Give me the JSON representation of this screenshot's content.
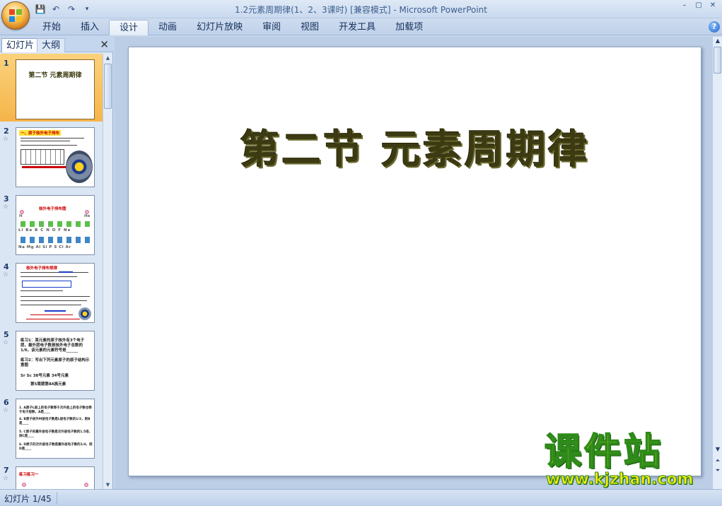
{
  "window": {
    "title": "1.2元素周期律(1、2、3课时) [兼容模式] - Microsoft PowerPoint",
    "controls": [
      "–",
      "▢",
      "✕"
    ]
  },
  "qat": {
    "save": "💾",
    "undo": "↶",
    "redo": "↷",
    "more": "▾"
  },
  "ribbon": {
    "tabs": [
      "开始",
      "插入",
      "设计",
      "动画",
      "幻灯片放映",
      "审阅",
      "视图",
      "开发工具",
      "加载项"
    ],
    "active_tab": "设计",
    "help": "?"
  },
  "left_panel": {
    "tabs": [
      "幻灯片",
      "大纲"
    ],
    "close": "✕",
    "slides": [
      {
        "num": "1",
        "title": "第二节 元素周期律"
      },
      {
        "num": "2",
        "title": "一、原子核外电子排布"
      },
      {
        "num": "3",
        "title": "核外电子排布图",
        "row1": [
          "H",
          "He"
        ],
        "row2": [
          "Li",
          "Be",
          "B",
          "C",
          "N",
          "O",
          "F",
          "Ne"
        ],
        "row3": [
          "Na",
          "Mg",
          "Al",
          "Si",
          "P",
          "S",
          "Cl",
          "Ar"
        ]
      },
      {
        "num": "4",
        "title": "核外电子排布规律"
      },
      {
        "num": "5",
        "lines": [
          "练习1：某元素的原子核外有3个电子层，最外层电子数是核外电子总数的1/6，该元素的元素符号是______",
          "练习2：写出下列元素原子的原子结构示意图",
          "Sr  Sc  38号元素  34号元素",
          "第5周期第ⅡA族元素"
        ]
      },
      {
        "num": "6",
        "lines": [
          "1. A原子L层上的电子数等于次外层上的电子数也等于电子层数，A是____",
          "4. B原子核外M层电子数是L层电子数的1/2，则B是____",
          "5. C原子的最外层电子数是次外层电子数的1.5倍，则C是____",
          "6. D原子的次外层电子数是最外层电子数的1/4，则D是____"
        ]
      },
      {
        "num": "7",
        "title": "练习练习一"
      }
    ]
  },
  "slide": {
    "title": "第二节  元素周期律"
  },
  "watermark": {
    "text": "课件站",
    "url": "www.kjzhan.com"
  },
  "status": {
    "slide_counter": "幻灯片 1/45"
  },
  "colors": {
    "title_dark_olive": "#3b3a12",
    "ribbon_blue": "#c5d5ea",
    "selected_thumb": "#f6b44a",
    "watermark_yellow": "#f4ea10",
    "watermark_green": "#2e8a1a"
  }
}
